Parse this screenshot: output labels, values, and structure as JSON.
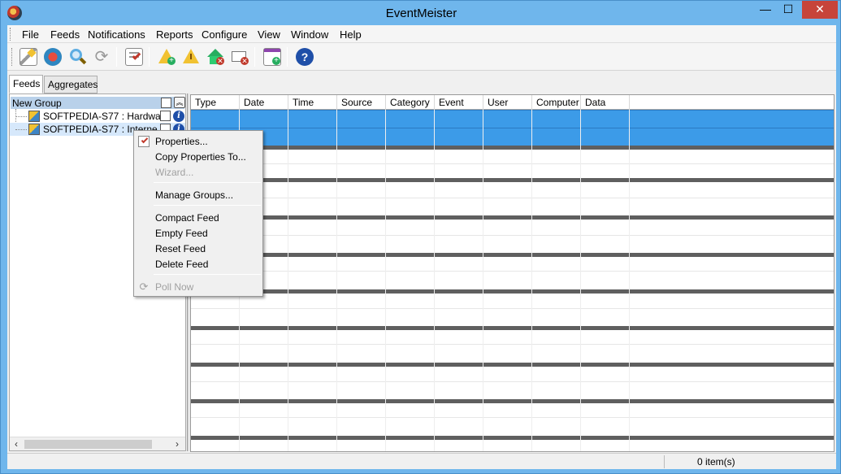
{
  "window": {
    "title": "EventMeister",
    "min_glyph": "—",
    "max_glyph": "☐",
    "close_glyph": "✕"
  },
  "menu": {
    "items": [
      "File",
      "Feeds",
      "Notifications",
      "Reports",
      "Configure",
      "View",
      "Window",
      "Help"
    ]
  },
  "toolbar": {
    "buttons": [
      {
        "icon": "wizard-wand-icon"
      },
      {
        "icon": "feeds-icon"
      },
      {
        "icon": "search-icon"
      },
      {
        "icon": "refresh-icon"
      },
      {
        "icon": "checklist-icon"
      },
      {
        "icon": "warning-add-icon"
      },
      {
        "icon": "warning-icon"
      },
      {
        "icon": "home-add-icon"
      },
      {
        "icon": "mail-delete-icon"
      },
      {
        "icon": "window-add-icon"
      },
      {
        "icon": "help-icon"
      }
    ]
  },
  "tabs": [
    "Feeds",
    "Aggregates"
  ],
  "tree": {
    "group": "New Group",
    "feeds": [
      {
        "label": "SOFTPEDIA-S77 : Hardwa...",
        "selected": false
      },
      {
        "label": "SOFTPEDIA-S77 : Interne",
        "selected": true
      }
    ]
  },
  "grid": {
    "columns": [
      "Type",
      "Date",
      "Time",
      "Source",
      "Category",
      "Event",
      "User",
      "Computer",
      "Data"
    ]
  },
  "context_menu": {
    "properties": "Properties...",
    "copy_properties": "Copy Properties To...",
    "wizard": "Wizard...",
    "manage_groups": "Manage Groups...",
    "compact_feed": "Compact Feed",
    "empty_feed": "Empty Feed",
    "reset_feed": "Reset Feed",
    "delete_feed": "Delete Feed",
    "poll_now": "Poll Now"
  },
  "status": {
    "items": "0 item(s)"
  },
  "colors": {
    "selection_blue": "#3c9be8",
    "window_frame": "#6fb6ec",
    "close_red": "#c7443a"
  }
}
